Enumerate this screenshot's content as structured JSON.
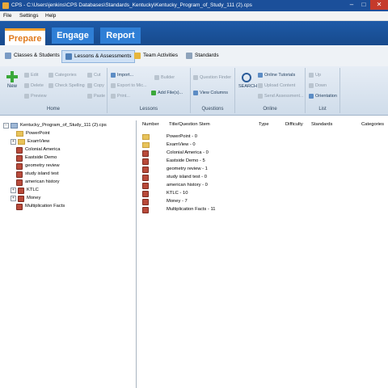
{
  "window": {
    "title": "CPS - C:\\Users\\jenkins\\CPS Databases\\Standards_Kentucky\\Kentucky_Program_of_Study_111 (2).cps"
  },
  "menu": [
    "File",
    "Settings",
    "Help"
  ],
  "main_tabs": [
    "Prepare",
    "Engage",
    "Report"
  ],
  "sub_tabs": [
    "Classes & Students",
    "Lessons & Assessments",
    "Team Activities",
    "Standards"
  ],
  "ribbon": {
    "home": {
      "label": "Home",
      "new": "New",
      "edit": "Edit",
      "delete": "Delete",
      "preview": "Preview",
      "categories": "Categories",
      "check_spelling": "Check Spelling",
      "cut": "Cut",
      "copy": "Copy",
      "paste": "Paste"
    },
    "lessons": {
      "label": "Lessons",
      "import": "Import...",
      "export": "Export to Mic...",
      "print": "Print...",
      "builder": "Builder",
      "add_files": "Add File(s)..."
    },
    "questions": {
      "label": "Questions",
      "question_finder": "Question Finder",
      "view_columns": "View Columns"
    },
    "online": {
      "label": "Online",
      "search": "SEARCH",
      "tutorials": "Online Tutorials",
      "upload": "Upload Content",
      "send": "Send Assessment..."
    },
    "list": {
      "label": "List",
      "up": "Up",
      "down": "Down",
      "orientation": "Orientation"
    }
  },
  "tree": {
    "root": "Kentucky_Program_of_Study_111 (2).cps",
    "items": [
      {
        "label": "PowerPoint",
        "type": "folder",
        "expandable": false
      },
      {
        "label": "ExamView",
        "type": "folder",
        "expandable": true
      },
      {
        "label": "Colonial America",
        "type": "book",
        "expandable": false
      },
      {
        "label": "Eastside Demo",
        "type": "book",
        "expandable": false
      },
      {
        "label": "geometry review",
        "type": "book",
        "expandable": false
      },
      {
        "label": "study island test",
        "type": "book",
        "expandable": false
      },
      {
        "label": "american history",
        "type": "book",
        "expandable": false
      },
      {
        "label": "KTLC",
        "type": "book",
        "expandable": true
      },
      {
        "label": "Money",
        "type": "book",
        "expandable": true
      },
      {
        "label": "Multiplication Facts",
        "type": "book",
        "expandable": false
      }
    ]
  },
  "table": {
    "columns": [
      "Number",
      "Title/Question Stem",
      "Type",
      "Difficulty",
      "Standards",
      "Categories"
    ],
    "rows": [
      {
        "type": "folder",
        "title": "PowerPoint - 0"
      },
      {
        "type": "folder",
        "title": "ExamView - 0"
      },
      {
        "type": "book",
        "title": "Colonial America - 0"
      },
      {
        "type": "book",
        "title": "Eastside Demo - 5"
      },
      {
        "type": "book",
        "title": "geometry review - 1"
      },
      {
        "type": "book",
        "title": "study island test - 0"
      },
      {
        "type": "book",
        "title": "american history - 0"
      },
      {
        "type": "book",
        "title": "KTLC - 10"
      },
      {
        "type": "book",
        "title": "Money - 7"
      },
      {
        "type": "book",
        "title": "Multiplication Facts - 11"
      }
    ]
  },
  "colors": {
    "titlebar": "#1b4f9a",
    "tabs": "#2f7fd6",
    "prepare_text": "#e07a1c",
    "folder": "#e8c35a",
    "book": "#b94a3a"
  }
}
